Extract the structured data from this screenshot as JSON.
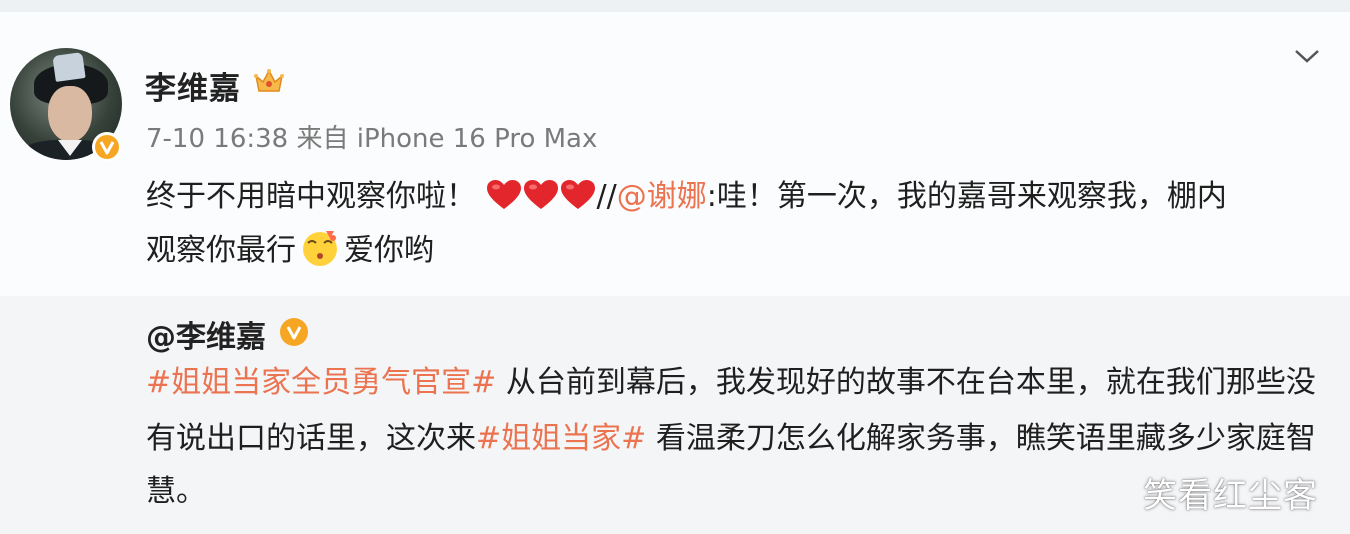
{
  "post": {
    "author": "李维嘉",
    "time": "7-10 16:38",
    "source": "来自 iPhone 16 Pro Max",
    "line1_text": "终于不用暗中观察你啦！",
    "line1_sep": "//",
    "line1_mention": "@谢娜",
    "line1_rest": ":哇！第一次，我的嘉哥来观察我，棚内",
    "line2_text": "观察你最行",
    "line2_tail": "爱你哟",
    "emoji_heart": "red-heart-icon",
    "emoji_face": "kiss-face-icon"
  },
  "quoted": {
    "author": "@李维嘉",
    "topic1": "#姐姐当家全员勇气官宣#",
    "line1_rest": " 从台前到幕后，我发现好的故事不在台本里，就在我们那些没",
    "line2_start": "有说出口的话里，这次来",
    "topic2": "#姐姐当家#",
    "line2_rest": " 看温柔刀怎么化解家务事，瞧笑语里藏多少家庭智",
    "line3": "慧。"
  },
  "watermark": "笑看红尘客",
  "colors": {
    "accent": "#eb7350",
    "badge": "#f6a623"
  }
}
